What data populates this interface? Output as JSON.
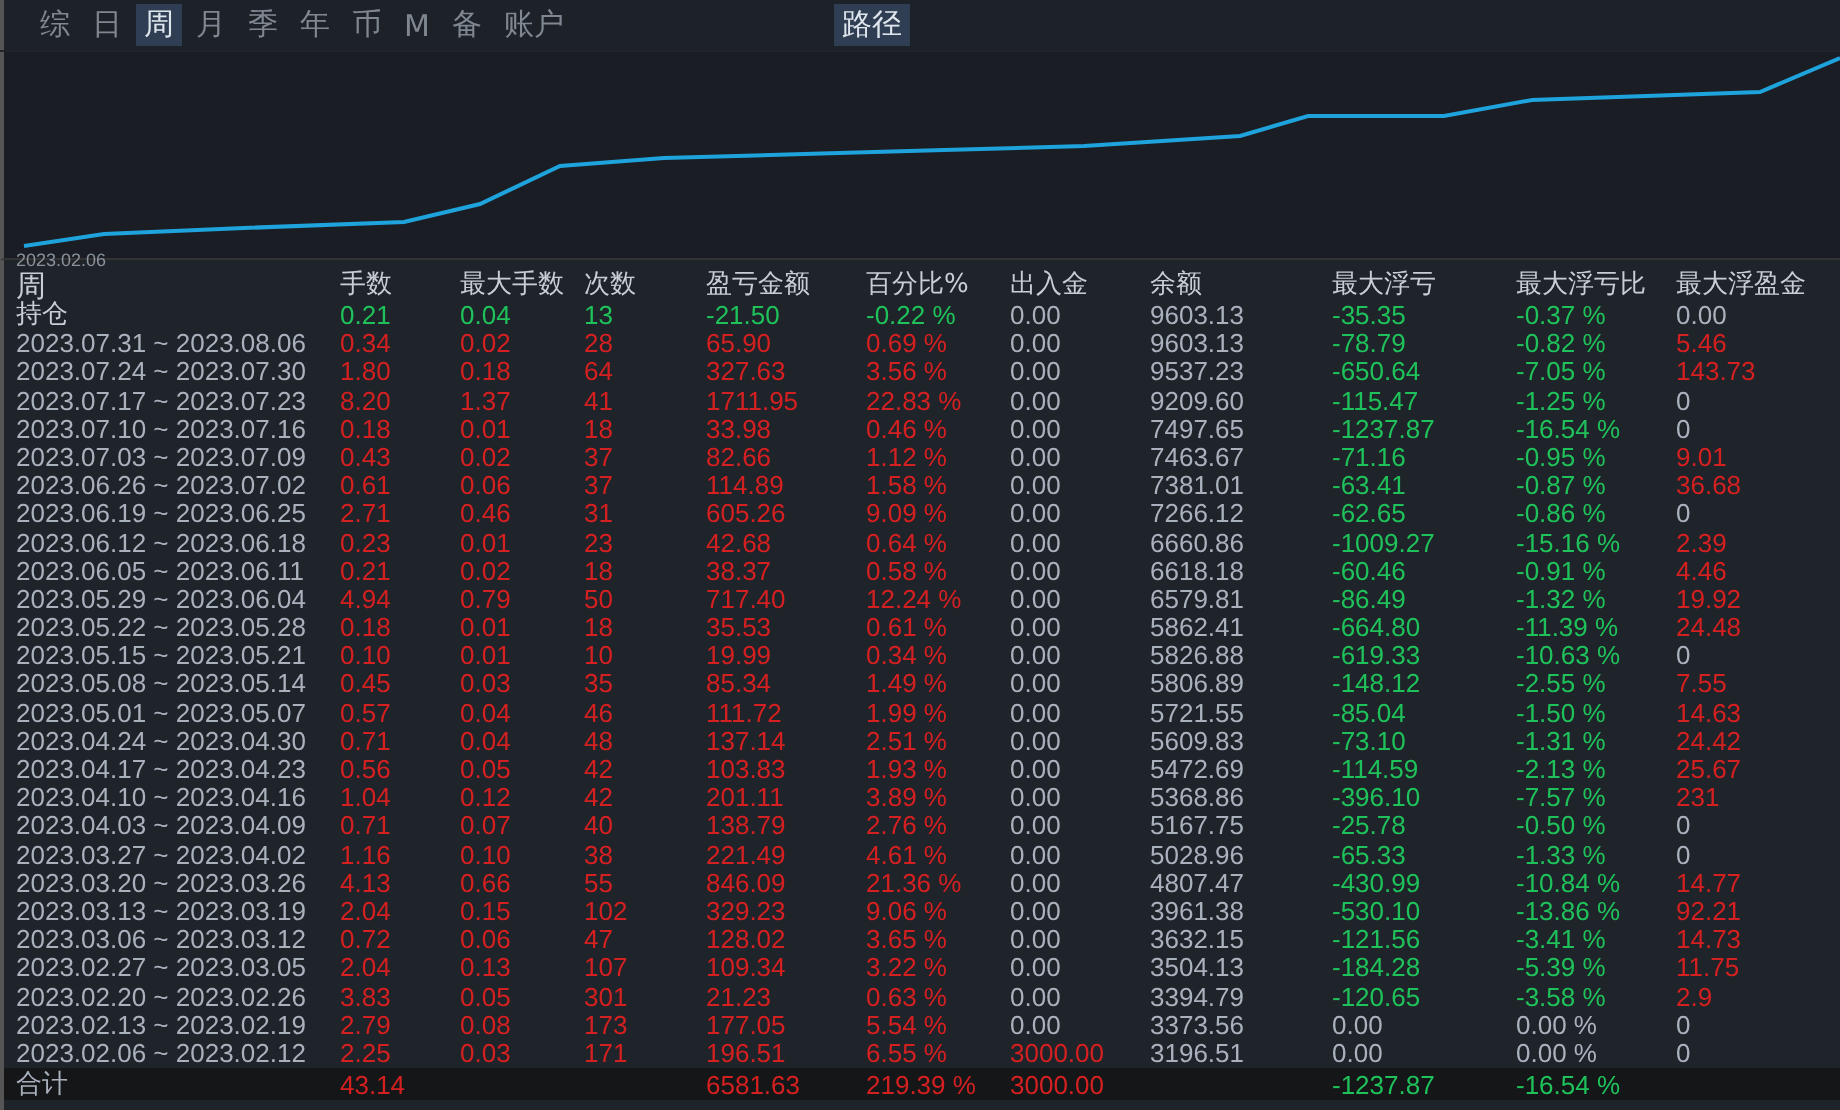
{
  "tabs": [
    {
      "label": "综",
      "selected": false
    },
    {
      "label": "日",
      "selected": false
    },
    {
      "label": "周",
      "selected": true
    },
    {
      "label": "月",
      "selected": false
    },
    {
      "label": "季",
      "selected": false
    },
    {
      "label": "年",
      "selected": false
    },
    {
      "label": "币",
      "selected": false
    },
    {
      "label": "M",
      "selected": false
    },
    {
      "label": "备",
      "selected": false
    },
    {
      "label": "账户",
      "selected": false
    }
  ],
  "path_tab": {
    "label": "路径",
    "selected": true
  },
  "equity_chart": {
    "start_label": "2023.02.06"
  },
  "table": {
    "columns": [
      "周",
      "手数",
      "最大手数",
      "次数",
      "盈亏金额",
      "百分比%",
      "出入金",
      "余额",
      "最大浮亏",
      "最大浮亏比",
      "最大浮盈金"
    ],
    "rows": [
      {
        "cells": [
          {
            "text": "持仓",
            "color": "#c8ced6"
          },
          {
            "text": "0.21",
            "color": "#1fc25a"
          },
          {
            "text": "0.04",
            "color": "#1fc25a"
          },
          {
            "text": "13",
            "color": "#1fc25a"
          },
          {
            "text": "-21.50",
            "color": "#1fc25a"
          },
          {
            "text": "-0.22 %",
            "color": "#1fc25a"
          },
          {
            "text": "0.00",
            "color": "#a9b1bd"
          },
          {
            "text": "9603.13",
            "color": "#a9b1bd"
          },
          {
            "text": "-35.35",
            "color": "#1fc25a"
          },
          {
            "text": "-0.37 %",
            "color": "#1fc25a"
          },
          {
            "text": "0.00",
            "color": "#a9b1bd"
          }
        ]
      },
      {
        "cells": [
          {
            "text": "2023.07.31 ~ 2023.08.06",
            "color": "#a9b1bd"
          },
          {
            "text": "0.34",
            "color": "#d42020"
          },
          {
            "text": "0.02",
            "color": "#d42020"
          },
          {
            "text": "28",
            "color": "#d42020"
          },
          {
            "text": "65.90",
            "color": "#d42020"
          },
          {
            "text": "0.69 %",
            "color": "#d42020"
          },
          {
            "text": "0.00",
            "color": "#a9b1bd"
          },
          {
            "text": "9603.13",
            "color": "#a9b1bd"
          },
          {
            "text": "-78.79",
            "color": "#1fc25a"
          },
          {
            "text": "-0.82 %",
            "color": "#1fc25a"
          },
          {
            "text": "5.46",
            "color": "#d42020"
          }
        ]
      },
      {
        "cells": [
          {
            "text": "2023.07.24 ~ 2023.07.30",
            "color": "#a9b1bd"
          },
          {
            "text": "1.80",
            "color": "#d42020"
          },
          {
            "text": "0.18",
            "color": "#d42020"
          },
          {
            "text": "64",
            "color": "#d42020"
          },
          {
            "text": "327.63",
            "color": "#d42020"
          },
          {
            "text": "3.56 %",
            "color": "#d42020"
          },
          {
            "text": "0.00",
            "color": "#a9b1bd"
          },
          {
            "text": "9537.23",
            "color": "#a9b1bd"
          },
          {
            "text": "-650.64",
            "color": "#1fc25a"
          },
          {
            "text": "-7.05 %",
            "color": "#1fc25a"
          },
          {
            "text": "143.73",
            "color": "#d42020"
          }
        ]
      },
      {
        "cells": [
          {
            "text": "2023.07.17 ~ 2023.07.23",
            "color": "#a9b1bd"
          },
          {
            "text": "8.20",
            "color": "#d42020"
          },
          {
            "text": "1.37",
            "color": "#d42020"
          },
          {
            "text": "41",
            "color": "#d42020"
          },
          {
            "text": "1711.95",
            "color": "#d42020"
          },
          {
            "text": "22.83 %",
            "color": "#d42020"
          },
          {
            "text": "0.00",
            "color": "#a9b1bd"
          },
          {
            "text": "9209.60",
            "color": "#a9b1bd"
          },
          {
            "text": "-115.47",
            "color": "#1fc25a"
          },
          {
            "text": "-1.25 %",
            "color": "#1fc25a"
          },
          {
            "text": "0",
            "color": "#a9b1bd"
          }
        ]
      },
      {
        "cells": [
          {
            "text": "2023.07.10 ~ 2023.07.16",
            "color": "#a9b1bd"
          },
          {
            "text": "0.18",
            "color": "#d42020"
          },
          {
            "text": "0.01",
            "color": "#d42020"
          },
          {
            "text": "18",
            "color": "#d42020"
          },
          {
            "text": "33.98",
            "color": "#d42020"
          },
          {
            "text": "0.46 %",
            "color": "#d42020"
          },
          {
            "text": "0.00",
            "color": "#a9b1bd"
          },
          {
            "text": "7497.65",
            "color": "#a9b1bd"
          },
          {
            "text": "-1237.87",
            "color": "#1fc25a"
          },
          {
            "text": "-16.54 %",
            "color": "#1fc25a"
          },
          {
            "text": "0",
            "color": "#a9b1bd"
          }
        ]
      },
      {
        "cells": [
          {
            "text": "2023.07.03 ~ 2023.07.09",
            "color": "#a9b1bd"
          },
          {
            "text": "0.43",
            "color": "#d42020"
          },
          {
            "text": "0.02",
            "color": "#d42020"
          },
          {
            "text": "37",
            "color": "#d42020"
          },
          {
            "text": "82.66",
            "color": "#d42020"
          },
          {
            "text": "1.12 %",
            "color": "#d42020"
          },
          {
            "text": "0.00",
            "color": "#a9b1bd"
          },
          {
            "text": "7463.67",
            "color": "#a9b1bd"
          },
          {
            "text": "-71.16",
            "color": "#1fc25a"
          },
          {
            "text": "-0.95 %",
            "color": "#1fc25a"
          },
          {
            "text": "9.01",
            "color": "#d42020"
          }
        ]
      },
      {
        "cells": [
          {
            "text": "2023.06.26 ~ 2023.07.02",
            "color": "#a9b1bd"
          },
          {
            "text": "0.61",
            "color": "#d42020"
          },
          {
            "text": "0.06",
            "color": "#d42020"
          },
          {
            "text": "37",
            "color": "#d42020"
          },
          {
            "text": "114.89",
            "color": "#d42020"
          },
          {
            "text": "1.58 %",
            "color": "#d42020"
          },
          {
            "text": "0.00",
            "color": "#a9b1bd"
          },
          {
            "text": "7381.01",
            "color": "#a9b1bd"
          },
          {
            "text": "-63.41",
            "color": "#1fc25a"
          },
          {
            "text": "-0.87 %",
            "color": "#1fc25a"
          },
          {
            "text": "36.68",
            "color": "#d42020"
          }
        ]
      },
      {
        "cells": [
          {
            "text": "2023.06.19 ~ 2023.06.25",
            "color": "#a9b1bd"
          },
          {
            "text": "2.71",
            "color": "#d42020"
          },
          {
            "text": "0.46",
            "color": "#d42020"
          },
          {
            "text": "31",
            "color": "#d42020"
          },
          {
            "text": "605.26",
            "color": "#d42020"
          },
          {
            "text": "9.09 %",
            "color": "#d42020"
          },
          {
            "text": "0.00",
            "color": "#a9b1bd"
          },
          {
            "text": "7266.12",
            "color": "#a9b1bd"
          },
          {
            "text": "-62.65",
            "color": "#1fc25a"
          },
          {
            "text": "-0.86 %",
            "color": "#1fc25a"
          },
          {
            "text": "0",
            "color": "#a9b1bd"
          }
        ]
      },
      {
        "cells": [
          {
            "text": "2023.06.12 ~ 2023.06.18",
            "color": "#a9b1bd"
          },
          {
            "text": "0.23",
            "color": "#d42020"
          },
          {
            "text": "0.01",
            "color": "#d42020"
          },
          {
            "text": "23",
            "color": "#d42020"
          },
          {
            "text": "42.68",
            "color": "#d42020"
          },
          {
            "text": "0.64 %",
            "color": "#d42020"
          },
          {
            "text": "0.00",
            "color": "#a9b1bd"
          },
          {
            "text": "6660.86",
            "color": "#a9b1bd"
          },
          {
            "text": "-1009.27",
            "color": "#1fc25a"
          },
          {
            "text": "-15.16 %",
            "color": "#1fc25a"
          },
          {
            "text": "2.39",
            "color": "#d42020"
          }
        ]
      },
      {
        "cells": [
          {
            "text": "2023.06.05 ~ 2023.06.11",
            "color": "#a9b1bd"
          },
          {
            "text": "0.21",
            "color": "#d42020"
          },
          {
            "text": "0.02",
            "color": "#d42020"
          },
          {
            "text": "18",
            "color": "#d42020"
          },
          {
            "text": "38.37",
            "color": "#d42020"
          },
          {
            "text": "0.58 %",
            "color": "#d42020"
          },
          {
            "text": "0.00",
            "color": "#a9b1bd"
          },
          {
            "text": "6618.18",
            "color": "#a9b1bd"
          },
          {
            "text": "-60.46",
            "color": "#1fc25a"
          },
          {
            "text": "-0.91 %",
            "color": "#1fc25a"
          },
          {
            "text": "4.46",
            "color": "#d42020"
          }
        ]
      },
      {
        "cells": [
          {
            "text": "2023.05.29 ~ 2023.06.04",
            "color": "#a9b1bd"
          },
          {
            "text": "4.94",
            "color": "#d42020"
          },
          {
            "text": "0.79",
            "color": "#d42020"
          },
          {
            "text": "50",
            "color": "#d42020"
          },
          {
            "text": "717.40",
            "color": "#d42020"
          },
          {
            "text": "12.24 %",
            "color": "#d42020"
          },
          {
            "text": "0.00",
            "color": "#a9b1bd"
          },
          {
            "text": "6579.81",
            "color": "#a9b1bd"
          },
          {
            "text": "-86.49",
            "color": "#1fc25a"
          },
          {
            "text": "-1.32 %",
            "color": "#1fc25a"
          },
          {
            "text": "19.92",
            "color": "#d42020"
          }
        ]
      },
      {
        "cells": [
          {
            "text": "2023.05.22 ~ 2023.05.28",
            "color": "#a9b1bd"
          },
          {
            "text": "0.18",
            "color": "#d42020"
          },
          {
            "text": "0.01",
            "color": "#d42020"
          },
          {
            "text": "18",
            "color": "#d42020"
          },
          {
            "text": "35.53",
            "color": "#d42020"
          },
          {
            "text": "0.61 %",
            "color": "#d42020"
          },
          {
            "text": "0.00",
            "color": "#a9b1bd"
          },
          {
            "text": "5862.41",
            "color": "#a9b1bd"
          },
          {
            "text": "-664.80",
            "color": "#1fc25a"
          },
          {
            "text": "-11.39 %",
            "color": "#1fc25a"
          },
          {
            "text": "24.48",
            "color": "#d42020"
          }
        ]
      },
      {
        "cells": [
          {
            "text": "2023.05.15 ~ 2023.05.21",
            "color": "#a9b1bd"
          },
          {
            "text": "0.10",
            "color": "#d42020"
          },
          {
            "text": "0.01",
            "color": "#d42020"
          },
          {
            "text": "10",
            "color": "#d42020"
          },
          {
            "text": "19.99",
            "color": "#d42020"
          },
          {
            "text": "0.34 %",
            "color": "#d42020"
          },
          {
            "text": "0.00",
            "color": "#a9b1bd"
          },
          {
            "text": "5826.88",
            "color": "#a9b1bd"
          },
          {
            "text": "-619.33",
            "color": "#1fc25a"
          },
          {
            "text": "-10.63 %",
            "color": "#1fc25a"
          },
          {
            "text": "0",
            "color": "#a9b1bd"
          }
        ]
      },
      {
        "cells": [
          {
            "text": "2023.05.08 ~ 2023.05.14",
            "color": "#a9b1bd"
          },
          {
            "text": "0.45",
            "color": "#d42020"
          },
          {
            "text": "0.03",
            "color": "#d42020"
          },
          {
            "text": "35",
            "color": "#d42020"
          },
          {
            "text": "85.34",
            "color": "#d42020"
          },
          {
            "text": "1.49 %",
            "color": "#d42020"
          },
          {
            "text": "0.00",
            "color": "#a9b1bd"
          },
          {
            "text": "5806.89",
            "color": "#a9b1bd"
          },
          {
            "text": "-148.12",
            "color": "#1fc25a"
          },
          {
            "text": "-2.55 %",
            "color": "#1fc25a"
          },
          {
            "text": "7.55",
            "color": "#d42020"
          }
        ]
      },
      {
        "cells": [
          {
            "text": "2023.05.01 ~ 2023.05.07",
            "color": "#a9b1bd"
          },
          {
            "text": "0.57",
            "color": "#d42020"
          },
          {
            "text": "0.04",
            "color": "#d42020"
          },
          {
            "text": "46",
            "color": "#d42020"
          },
          {
            "text": "111.72",
            "color": "#d42020"
          },
          {
            "text": "1.99 %",
            "color": "#d42020"
          },
          {
            "text": "0.00",
            "color": "#a9b1bd"
          },
          {
            "text": "5721.55",
            "color": "#a9b1bd"
          },
          {
            "text": "-85.04",
            "color": "#1fc25a"
          },
          {
            "text": "-1.50 %",
            "color": "#1fc25a"
          },
          {
            "text": "14.63",
            "color": "#d42020"
          }
        ]
      },
      {
        "cells": [
          {
            "text": "2023.04.24 ~ 2023.04.30",
            "color": "#a9b1bd"
          },
          {
            "text": "0.71",
            "color": "#d42020"
          },
          {
            "text": "0.04",
            "color": "#d42020"
          },
          {
            "text": "48",
            "color": "#d42020"
          },
          {
            "text": "137.14",
            "color": "#d42020"
          },
          {
            "text": "2.51 %",
            "color": "#d42020"
          },
          {
            "text": "0.00",
            "color": "#a9b1bd"
          },
          {
            "text": "5609.83",
            "color": "#a9b1bd"
          },
          {
            "text": "-73.10",
            "color": "#1fc25a"
          },
          {
            "text": "-1.31 %",
            "color": "#1fc25a"
          },
          {
            "text": "24.42",
            "color": "#d42020"
          }
        ]
      },
      {
        "cells": [
          {
            "text": "2023.04.17 ~ 2023.04.23",
            "color": "#a9b1bd"
          },
          {
            "text": "0.56",
            "color": "#d42020"
          },
          {
            "text": "0.05",
            "color": "#d42020"
          },
          {
            "text": "42",
            "color": "#d42020"
          },
          {
            "text": "103.83",
            "color": "#d42020"
          },
          {
            "text": "1.93 %",
            "color": "#d42020"
          },
          {
            "text": "0.00",
            "color": "#a9b1bd"
          },
          {
            "text": "5472.69",
            "color": "#a9b1bd"
          },
          {
            "text": "-114.59",
            "color": "#1fc25a"
          },
          {
            "text": "-2.13 %",
            "color": "#1fc25a"
          },
          {
            "text": "25.67",
            "color": "#d42020"
          }
        ]
      },
      {
        "cells": [
          {
            "text": "2023.04.10 ~ 2023.04.16",
            "color": "#a9b1bd"
          },
          {
            "text": "1.04",
            "color": "#d42020"
          },
          {
            "text": "0.12",
            "color": "#d42020"
          },
          {
            "text": "42",
            "color": "#d42020"
          },
          {
            "text": "201.11",
            "color": "#d42020"
          },
          {
            "text": "3.89 %",
            "color": "#d42020"
          },
          {
            "text": "0.00",
            "color": "#a9b1bd"
          },
          {
            "text": "5368.86",
            "color": "#a9b1bd"
          },
          {
            "text": "-396.10",
            "color": "#1fc25a"
          },
          {
            "text": "-7.57 %",
            "color": "#1fc25a"
          },
          {
            "text": "231",
            "color": "#d42020"
          }
        ]
      },
      {
        "cells": [
          {
            "text": "2023.04.03 ~ 2023.04.09",
            "color": "#a9b1bd"
          },
          {
            "text": "0.71",
            "color": "#d42020"
          },
          {
            "text": "0.07",
            "color": "#d42020"
          },
          {
            "text": "40",
            "color": "#d42020"
          },
          {
            "text": "138.79",
            "color": "#d42020"
          },
          {
            "text": "2.76 %",
            "color": "#d42020"
          },
          {
            "text": "0.00",
            "color": "#a9b1bd"
          },
          {
            "text": "5167.75",
            "color": "#a9b1bd"
          },
          {
            "text": "-25.78",
            "color": "#1fc25a"
          },
          {
            "text": "-0.50 %",
            "color": "#1fc25a"
          },
          {
            "text": "0",
            "color": "#a9b1bd"
          }
        ]
      },
      {
        "cells": [
          {
            "text": "2023.03.27 ~ 2023.04.02",
            "color": "#a9b1bd"
          },
          {
            "text": "1.16",
            "color": "#d42020"
          },
          {
            "text": "0.10",
            "color": "#d42020"
          },
          {
            "text": "38",
            "color": "#d42020"
          },
          {
            "text": "221.49",
            "color": "#d42020"
          },
          {
            "text": "4.61 %",
            "color": "#d42020"
          },
          {
            "text": "0.00",
            "color": "#a9b1bd"
          },
          {
            "text": "5028.96",
            "color": "#a9b1bd"
          },
          {
            "text": "-65.33",
            "color": "#1fc25a"
          },
          {
            "text": "-1.33 %",
            "color": "#1fc25a"
          },
          {
            "text": "0",
            "color": "#a9b1bd"
          }
        ]
      },
      {
        "cells": [
          {
            "text": "2023.03.20 ~ 2023.03.26",
            "color": "#a9b1bd"
          },
          {
            "text": "4.13",
            "color": "#d42020"
          },
          {
            "text": "0.66",
            "color": "#d42020"
          },
          {
            "text": "55",
            "color": "#d42020"
          },
          {
            "text": "846.09",
            "color": "#d42020"
          },
          {
            "text": "21.36 %",
            "color": "#d42020"
          },
          {
            "text": "0.00",
            "color": "#a9b1bd"
          },
          {
            "text": "4807.47",
            "color": "#a9b1bd"
          },
          {
            "text": "-430.99",
            "color": "#1fc25a"
          },
          {
            "text": "-10.84 %",
            "color": "#1fc25a"
          },
          {
            "text": "14.77",
            "color": "#d42020"
          }
        ]
      },
      {
        "cells": [
          {
            "text": "2023.03.13 ~ 2023.03.19",
            "color": "#a9b1bd"
          },
          {
            "text": "2.04",
            "color": "#d42020"
          },
          {
            "text": "0.15",
            "color": "#d42020"
          },
          {
            "text": "102",
            "color": "#d42020"
          },
          {
            "text": "329.23",
            "color": "#d42020"
          },
          {
            "text": "9.06 %",
            "color": "#d42020"
          },
          {
            "text": "0.00",
            "color": "#a9b1bd"
          },
          {
            "text": "3961.38",
            "color": "#a9b1bd"
          },
          {
            "text": "-530.10",
            "color": "#1fc25a"
          },
          {
            "text": "-13.86 %",
            "color": "#1fc25a"
          },
          {
            "text": "92.21",
            "color": "#d42020"
          }
        ]
      },
      {
        "cells": [
          {
            "text": "2023.03.06 ~ 2023.03.12",
            "color": "#a9b1bd"
          },
          {
            "text": "0.72",
            "color": "#d42020"
          },
          {
            "text": "0.06",
            "color": "#d42020"
          },
          {
            "text": "47",
            "color": "#d42020"
          },
          {
            "text": "128.02",
            "color": "#d42020"
          },
          {
            "text": "3.65 %",
            "color": "#d42020"
          },
          {
            "text": "0.00",
            "color": "#a9b1bd"
          },
          {
            "text": "3632.15",
            "color": "#a9b1bd"
          },
          {
            "text": "-121.56",
            "color": "#1fc25a"
          },
          {
            "text": "-3.41 %",
            "color": "#1fc25a"
          },
          {
            "text": "14.73",
            "color": "#d42020"
          }
        ]
      },
      {
        "cells": [
          {
            "text": "2023.02.27 ~ 2023.03.05",
            "color": "#a9b1bd"
          },
          {
            "text": "2.04",
            "color": "#d42020"
          },
          {
            "text": "0.13",
            "color": "#d42020"
          },
          {
            "text": "107",
            "color": "#d42020"
          },
          {
            "text": "109.34",
            "color": "#d42020"
          },
          {
            "text": "3.22 %",
            "color": "#d42020"
          },
          {
            "text": "0.00",
            "color": "#a9b1bd"
          },
          {
            "text": "3504.13",
            "color": "#a9b1bd"
          },
          {
            "text": "-184.28",
            "color": "#1fc25a"
          },
          {
            "text": "-5.39 %",
            "color": "#1fc25a"
          },
          {
            "text": "11.75",
            "color": "#d42020"
          }
        ]
      },
      {
        "cells": [
          {
            "text": "2023.02.20 ~ 2023.02.26",
            "color": "#a9b1bd"
          },
          {
            "text": "3.83",
            "color": "#d42020"
          },
          {
            "text": "0.05",
            "color": "#d42020"
          },
          {
            "text": "301",
            "color": "#d42020"
          },
          {
            "text": "21.23",
            "color": "#d42020"
          },
          {
            "text": "0.63 %",
            "color": "#d42020"
          },
          {
            "text": "0.00",
            "color": "#a9b1bd"
          },
          {
            "text": "3394.79",
            "color": "#a9b1bd"
          },
          {
            "text": "-120.65",
            "color": "#1fc25a"
          },
          {
            "text": "-3.58 %",
            "color": "#1fc25a"
          },
          {
            "text": "2.9",
            "color": "#d42020"
          }
        ]
      },
      {
        "cells": [
          {
            "text": "2023.02.13 ~ 2023.02.19",
            "color": "#a9b1bd"
          },
          {
            "text": "2.79",
            "color": "#d42020"
          },
          {
            "text": "0.08",
            "color": "#d42020"
          },
          {
            "text": "173",
            "color": "#d42020"
          },
          {
            "text": "177.05",
            "color": "#d42020"
          },
          {
            "text": "5.54 %",
            "color": "#d42020"
          },
          {
            "text": "0.00",
            "color": "#a9b1bd"
          },
          {
            "text": "3373.56",
            "color": "#a9b1bd"
          },
          {
            "text": "0.00",
            "color": "#a9b1bd"
          },
          {
            "text": "0.00 %",
            "color": "#a9b1bd"
          },
          {
            "text": "0",
            "color": "#a9b1bd"
          }
        ]
      },
      {
        "cells": [
          {
            "text": "2023.02.06 ~ 2023.02.12",
            "color": "#a9b1bd"
          },
          {
            "text": "2.25",
            "color": "#d42020"
          },
          {
            "text": "0.03",
            "color": "#d42020"
          },
          {
            "text": "171",
            "color": "#d42020"
          },
          {
            "text": "196.51",
            "color": "#d42020"
          },
          {
            "text": "6.55 %",
            "color": "#d42020"
          },
          {
            "text": "3000.00",
            "color": "#d42020"
          },
          {
            "text": "3196.51",
            "color": "#a9b1bd"
          },
          {
            "text": "0.00",
            "color": "#a9b1bd"
          },
          {
            "text": "0.00 %",
            "color": "#a9b1bd"
          },
          {
            "text": "0",
            "color": "#a9b1bd"
          }
        ]
      }
    ],
    "total": {
      "label": {
        "text": "合计",
        "color": "#a9b1bd"
      },
      "lots": {
        "text": "43.14",
        "color": "#d42020"
      },
      "pnl": {
        "text": "6581.63",
        "color": "#d42020"
      },
      "pct": {
        "text": "219.39 %",
        "color": "#d42020"
      },
      "flow": {
        "text": "3000.00",
        "color": "#d42020"
      },
      "max_float_loss": {
        "text": "-1237.87",
        "color": "#1fc25a"
      },
      "max_float_loss_pct": {
        "text": "-16.54 %",
        "color": "#1fc25a"
      }
    }
  }
}
